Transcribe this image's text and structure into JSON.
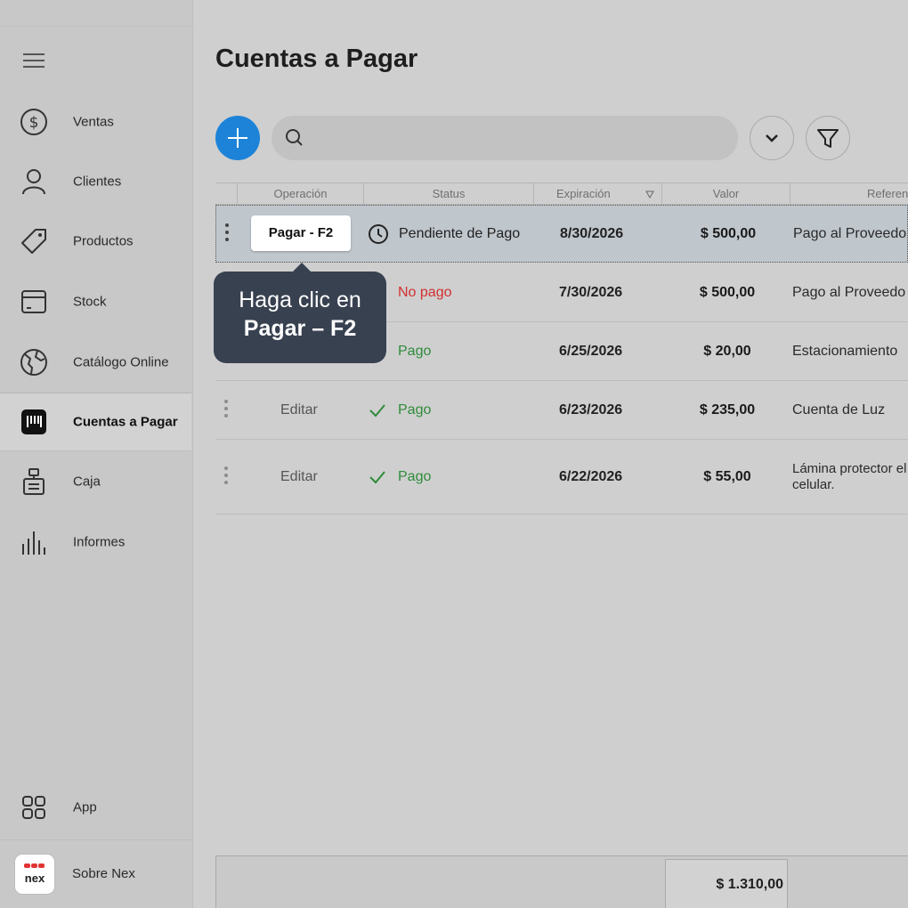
{
  "page": {
    "title": "Cuentas a Pagar"
  },
  "sidebar": {
    "items": [
      {
        "label": "Ventas",
        "icon": "dollar-circle-icon"
      },
      {
        "label": "Clientes",
        "icon": "user-icon"
      },
      {
        "label": "Productos",
        "icon": "tag-icon"
      },
      {
        "label": "Stock",
        "icon": "box-icon"
      },
      {
        "label": "Catálogo Online",
        "icon": "globe-icon"
      },
      {
        "label": "Cuentas a Pagar",
        "icon": "barcode-icon",
        "active": true
      },
      {
        "label": "Caja",
        "icon": "cash-register-icon"
      },
      {
        "label": "Informes",
        "icon": "bar-chart-icon"
      }
    ],
    "app_label": "App",
    "about_label": "Sobre Nex",
    "logo_text": "nex"
  },
  "table": {
    "headers": [
      "Operación",
      "Status",
      "Expiración",
      "Valor",
      "Referen"
    ],
    "rows": [
      {
        "operation": "Pagar - F2",
        "status": "Pendiente de Pago",
        "status_type": "pending",
        "expiration": "8/30/2026",
        "value": "$ 500,00",
        "reference": "Pago al Proveedo",
        "selected": true
      },
      {
        "operation": "",
        "status": "No pago",
        "status_type": "unpaid",
        "expiration": "7/30/2026",
        "value": "$ 500,00",
        "reference": "Pago al Proveedo"
      },
      {
        "operation": "",
        "status": "Pago",
        "status_type": "paid",
        "expiration": "6/25/2026",
        "value": "$ 20,00",
        "reference": "Estacionamiento"
      },
      {
        "operation": "Editar",
        "status": "Pago",
        "status_type": "paid",
        "expiration": "6/23/2026",
        "value": "$ 235,00",
        "reference": "Cuenta de Luz"
      },
      {
        "operation": "Editar",
        "status": "Pago",
        "status_type": "paid",
        "expiration": "6/22/2026",
        "value": "$ 55,00",
        "reference": "Lámina protector el celular."
      }
    ],
    "total": "$ 1.310,00"
  },
  "tooltip": {
    "line1": "Haga clic en",
    "line2": "Pagar – F2"
  },
  "colors": {
    "accent": "#1d83d8",
    "paid": "#2e8b3a",
    "unpaid": "#d32f2f",
    "tooltip_bg": "#384150"
  }
}
